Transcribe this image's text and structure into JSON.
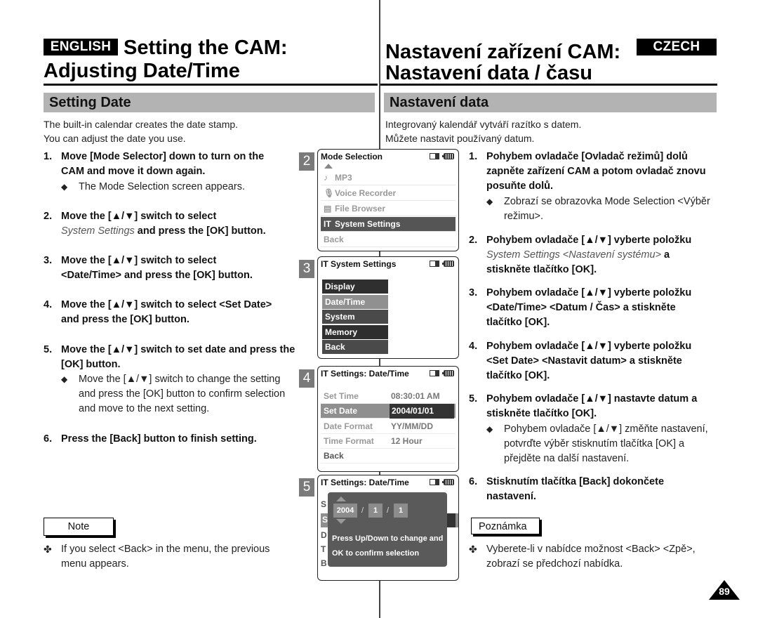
{
  "header": {
    "english_badge": "ENGLISH",
    "english_title_line1": "Setting the CAM:",
    "english_title_line2": "Adjusting Date/Time",
    "czech_badge": "CZECH",
    "czech_title_line1": "Nastavení zařízení CAM:",
    "czech_title_line2": "Nastavení data / času"
  },
  "english": {
    "section_title": "Setting Date",
    "intro_line1": "The built-in calendar creates the date stamp.",
    "intro_line2": "You can adjust the date you use.",
    "steps": [
      {
        "num": "1.",
        "text": "Move [Mode Selector] down to turn on the CAM and move it down again."
      },
      {
        "num": "2.",
        "text_italic": "System Settings",
        "text_rest": " and press the [OK] button.",
        "text_pre": "Move the [▲/▼] switch to select"
      },
      {
        "num": "3.",
        "text": "Move the [▲/▼] switch to select <Date/Time> and press the [OK] button."
      },
      {
        "num": "4.",
        "text": "Move the [▲/▼] switch to select <Set Date> and press the [OK] button."
      },
      {
        "num": "5.",
        "text": "Move the [▲/▼] switch to set date and press the [OK] button."
      },
      {
        "num": "6.",
        "text": "Press the [Back] button to finish setting."
      }
    ],
    "sub_bullets": {
      "step1": "The Mode Selection screen appears.",
      "step5": "Move the [▲/▼] switch to change the setting and press the [OK] button to confirm selection and move to the next setting."
    },
    "bullet_symbol": "◆",
    "note_label": "Note",
    "note_symbol": "✤",
    "note_text": "If you select <Back> in the menu, the previous menu appears."
  },
  "czech": {
    "section_title": "Nastavení data",
    "intro_line1": "Integrovaný kalendář vytváří razítko s datem.",
    "intro_line2": "Můžete nastavit používaný datum.",
    "steps": [
      {
        "num": "1.",
        "text": "Pohybem ovladače [Ovladač režimů] dolů zapněte zařízení CAM a potom ovladač znovu posuňte dolů."
      },
      {
        "num": "2.",
        "text_pre": "Pohybem ovladače [▲/▼] vyberte položku",
        "text_italic": "System Settings <Nastavení systému>",
        "text_rest": " a stiskněte tlačítko [OK]."
      },
      {
        "num": "3.",
        "text": "Pohybem ovladače [▲/▼] vyberte položku <Date/Time> <Datum / Čas> a stiskněte tlačítko [OK]."
      },
      {
        "num": "4.",
        "text": "Pohybem ovladače [▲/▼] vyberte položku <Set Date> <Nastavit datum> a stiskněte tlačítko [OK]."
      },
      {
        "num": "5.",
        "text": "Pohybem ovladače [▲/▼] nastavte datum a stiskněte tlačítko [OK]."
      },
      {
        "num": "6.",
        "text": "Stisknutím tlačítka [Back] dokončete nastavení."
      }
    ],
    "sub_bullets": {
      "step1": "Zobrazí se obrazovka Mode Selection <Výběr režimu>.",
      "step5": "Pohybem ovladače [▲/▼] změňte nastavení, potvrďte výběr stisknutím tlačítka [OK] a přejděte na další nastavení."
    },
    "note_label": "Poznámka",
    "note_text": "Vyberete-li v nabídce možnost <Back> <Zpě>, zobrazí se předchozí nabídka."
  },
  "screens": [
    {
      "num": "2",
      "title": "Mode Selection",
      "items": [
        {
          "icon": "♪",
          "label": "MP3"
        },
        {
          "icon": "🎙",
          "label": "Voice Recorder"
        },
        {
          "icon": "▤",
          "label": "File Browser"
        },
        {
          "icon": "⚒",
          "label": "System Settings",
          "selected": true
        },
        {
          "icon": "",
          "label": "Back"
        }
      ]
    },
    {
      "num": "3",
      "title": "System Settings",
      "items": [
        "Display",
        "Date/Time",
        "System",
        "Memory",
        "Back"
      ],
      "selected": "Date/Time"
    },
    {
      "num": "4",
      "title": "Settings: Date/Time",
      "rows": [
        {
          "key": "Set Time",
          "value": "08:30:01 AM"
        },
        {
          "key": "Set Date",
          "value": "2004/01/01",
          "selected": true
        },
        {
          "key": "Date Format",
          "value": "YY/MM/DD"
        },
        {
          "key": "Time Format",
          "value": "12 Hour"
        },
        {
          "key": "Back",
          "value": ""
        }
      ]
    },
    {
      "num": "5",
      "title": "Settings: Date/Time",
      "spinner": {
        "year": "2004",
        "month": "1",
        "day": "1",
        "separator": "/"
      },
      "message_line1": "Press Up/Down to change and",
      "message_line2": "OK to confirm selection",
      "hidden_row_initials": [
        "S",
        "S",
        "D",
        "T",
        "B"
      ]
    }
  ],
  "settings_icon": "IT",
  "page_number": "89"
}
